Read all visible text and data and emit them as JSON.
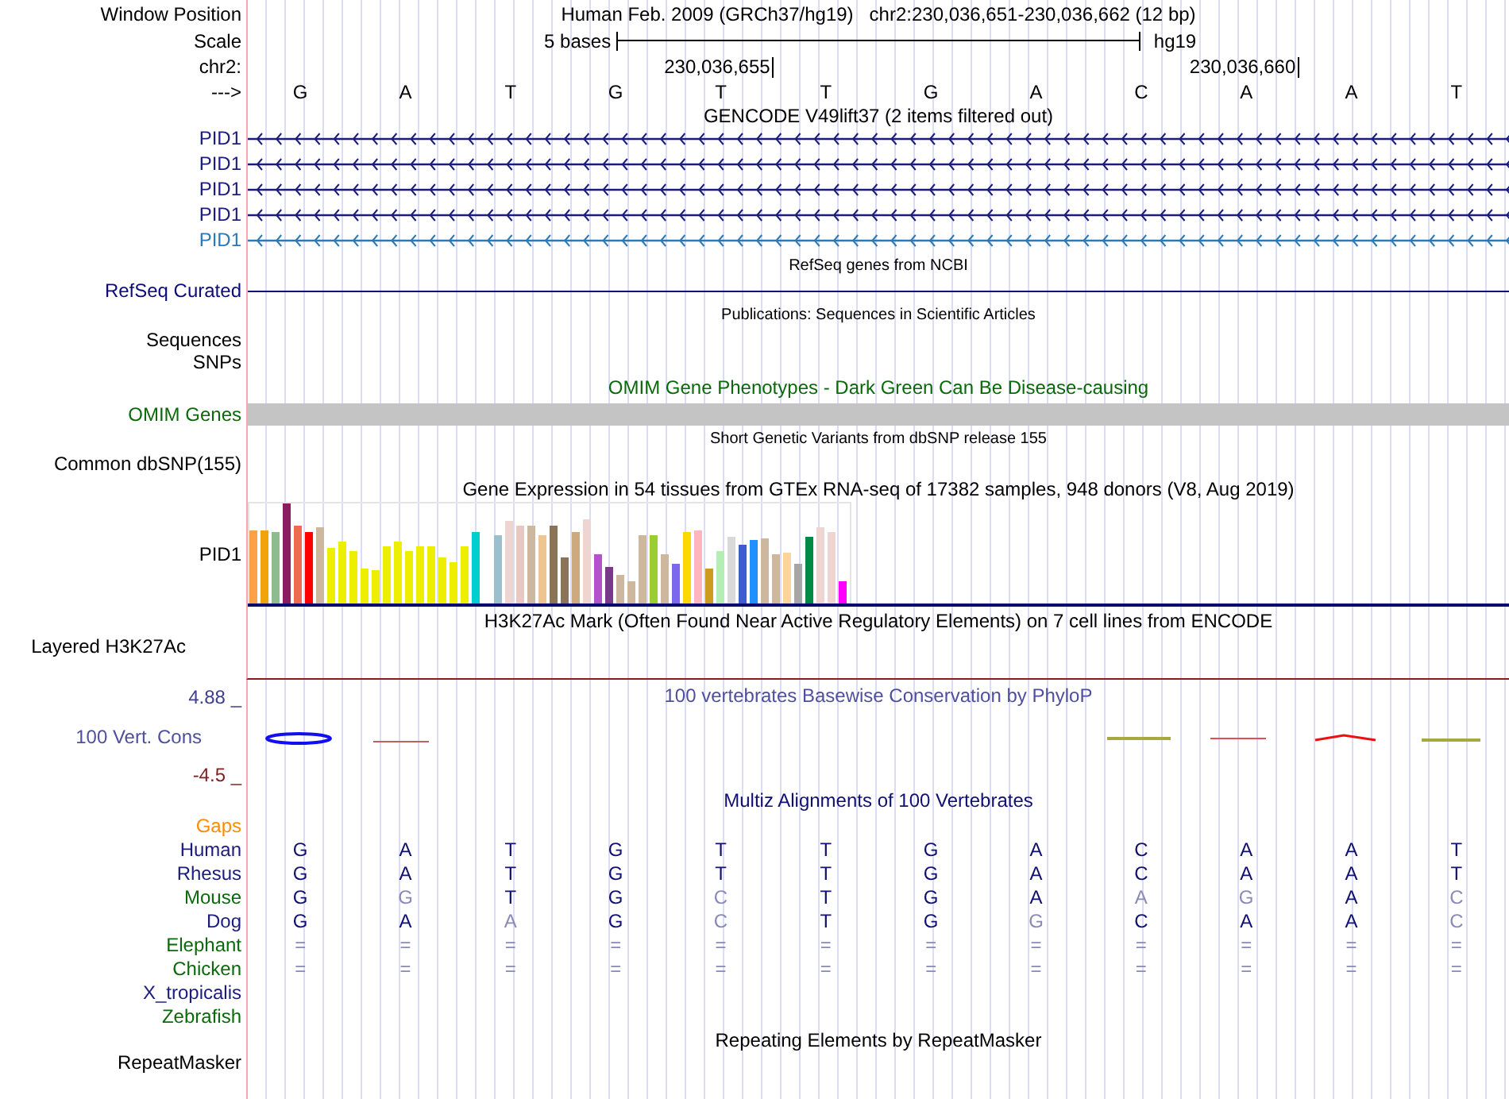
{
  "header": {
    "position_label": "Window Position",
    "position": "Human Feb. 2009 (GRCh37/hg19)   chr2:230,036,651-230,036,662 (12 bp)",
    "scale_label": "Scale",
    "scale_text": "5 bases",
    "assembly": "hg19",
    "chrom_label": "chr2:",
    "ticks": [
      "230,036,655",
      "230,036,660"
    ],
    "strand_label": "--->",
    "bases": [
      "G",
      "A",
      "T",
      "G",
      "T",
      "T",
      "G",
      "A",
      "C",
      "A",
      "A",
      "T"
    ]
  },
  "gencode": {
    "title": "GENCODE V49lift37 (2 items filtered out)",
    "items": [
      {
        "name": "PID1",
        "color": "#1c1c80"
      },
      {
        "name": "PID1",
        "color": "#1c1c80"
      },
      {
        "name": "PID1",
        "color": "#1c1c80"
      },
      {
        "name": "PID1",
        "color": "#1c1c80"
      },
      {
        "name": "PID1",
        "color": "#2a7ab8"
      }
    ]
  },
  "refseq": {
    "title": "RefSeq genes from NCBI",
    "label": "RefSeq Curated"
  },
  "publications": {
    "title": "Publications: Sequences in Scientific Articles",
    "labels": [
      "Sequences",
      "SNPs"
    ]
  },
  "omim": {
    "title": "OMIM Gene Phenotypes - Dark Green Can Be Disease-causing",
    "label": "OMIM Genes"
  },
  "dbsnp": {
    "title": "Short Genetic Variants from dbSNP release 155",
    "label": "Common dbSNP(155)"
  },
  "gtex": {
    "title": "Gene Expression in 54 tissues from GTEx RNA-seq of 17382 samples, 948 donors (V8, Aug 2019)",
    "label": "PID1"
  },
  "h3k27ac": {
    "title": "H3K27Ac Mark (Often Found Near Active Regulatory Elements) on 7 cell lines from ENCODE",
    "label": "Layered H3K27Ac"
  },
  "conservation": {
    "title": "100 vertebrates Basewise Conservation by PhyloP",
    "label": "100 Vert. Cons",
    "max": "4.88 _",
    "min": "-4.5 _"
  },
  "multiz": {
    "title": "Multiz Alignments of 100 Vertebrates",
    "gaps_label": "Gaps",
    "species": [
      {
        "name": "Human",
        "color": "#1c1c80",
        "bases": [
          {
            "b": "G",
            "conserved": true
          },
          {
            "b": "A",
            "conserved": true
          },
          {
            "b": "T",
            "conserved": true
          },
          {
            "b": "G",
            "conserved": true
          },
          {
            "b": "T",
            "conserved": true
          },
          {
            "b": "T",
            "conserved": true
          },
          {
            "b": "G",
            "conserved": true
          },
          {
            "b": "A",
            "conserved": true
          },
          {
            "b": "C",
            "conserved": true
          },
          {
            "b": "A",
            "conserved": true
          },
          {
            "b": "A",
            "conserved": true
          },
          {
            "b": "T",
            "conserved": true
          }
        ]
      },
      {
        "name": "Rhesus",
        "color": "#1c1c80",
        "bases": [
          {
            "b": "G",
            "conserved": true
          },
          {
            "b": "A",
            "conserved": true
          },
          {
            "b": "T",
            "conserved": true
          },
          {
            "b": "G",
            "conserved": true
          },
          {
            "b": "T",
            "conserved": true
          },
          {
            "b": "T",
            "conserved": true
          },
          {
            "b": "G",
            "conserved": true
          },
          {
            "b": "A",
            "conserved": true
          },
          {
            "b": "C",
            "conserved": true
          },
          {
            "b": "A",
            "conserved": true
          },
          {
            "b": "A",
            "conserved": true
          },
          {
            "b": "T",
            "conserved": true
          }
        ]
      },
      {
        "name": "Mouse",
        "color": "#0a6a0a",
        "bases": [
          {
            "b": "G",
            "conserved": true
          },
          {
            "b": "G",
            "conserved": false
          },
          {
            "b": "T",
            "conserved": true
          },
          {
            "b": "G",
            "conserved": true
          },
          {
            "b": "C",
            "conserved": false
          },
          {
            "b": "T",
            "conserved": true
          },
          {
            "b": "G",
            "conserved": true
          },
          {
            "b": "A",
            "conserved": true
          },
          {
            "b": "A",
            "conserved": false
          },
          {
            "b": "G",
            "conserved": false
          },
          {
            "b": "A",
            "conserved": true
          },
          {
            "b": "C",
            "conserved": false
          }
        ]
      },
      {
        "name": "Dog",
        "color": "#1c1c80",
        "bases": [
          {
            "b": "G",
            "conserved": true
          },
          {
            "b": "A",
            "conserved": true
          },
          {
            "b": "A",
            "conserved": false
          },
          {
            "b": "G",
            "conserved": true
          },
          {
            "b": "C",
            "conserved": false
          },
          {
            "b": "T",
            "conserved": true
          },
          {
            "b": "G",
            "conserved": true
          },
          {
            "b": "G",
            "conserved": false
          },
          {
            "b": "C",
            "conserved": true
          },
          {
            "b": "A",
            "conserved": true
          },
          {
            "b": "A",
            "conserved": true
          },
          {
            "b": "C",
            "conserved": false
          }
        ]
      },
      {
        "name": "Elephant",
        "color": "#0a6a0a",
        "bases": [
          {
            "b": "=",
            "conserved": false
          },
          {
            "b": "=",
            "conserved": false
          },
          {
            "b": "=",
            "conserved": false
          },
          {
            "b": "=",
            "conserved": false
          },
          {
            "b": "=",
            "conserved": false
          },
          {
            "b": "=",
            "conserved": false
          },
          {
            "b": "=",
            "conserved": false
          },
          {
            "b": "=",
            "conserved": false
          },
          {
            "b": "=",
            "conserved": false
          },
          {
            "b": "=",
            "conserved": false
          },
          {
            "b": "=",
            "conserved": false
          },
          {
            "b": "=",
            "conserved": false
          }
        ]
      },
      {
        "name": "Chicken",
        "color": "#0a6a0a",
        "bases": [
          {
            "b": "=",
            "conserved": false
          },
          {
            "b": "=",
            "conserved": false
          },
          {
            "b": "=",
            "conserved": false
          },
          {
            "b": "=",
            "conserved": false
          },
          {
            "b": "=",
            "conserved": false
          },
          {
            "b": "=",
            "conserved": false
          },
          {
            "b": "=",
            "conserved": false
          },
          {
            "b": "=",
            "conserved": false
          },
          {
            "b": "=",
            "conserved": false
          },
          {
            "b": "=",
            "conserved": false
          },
          {
            "b": "=",
            "conserved": false
          },
          {
            "b": "=",
            "conserved": false
          }
        ]
      },
      {
        "name": "X_tropicalis",
        "color": "#1c1c80"
      },
      {
        "name": "Zebrafish",
        "color": "#0a6a0a"
      }
    ]
  },
  "repeatmasker": {
    "title": "Repeating Elements by RepeatMasker",
    "label": "RepeatMasker"
  }
}
